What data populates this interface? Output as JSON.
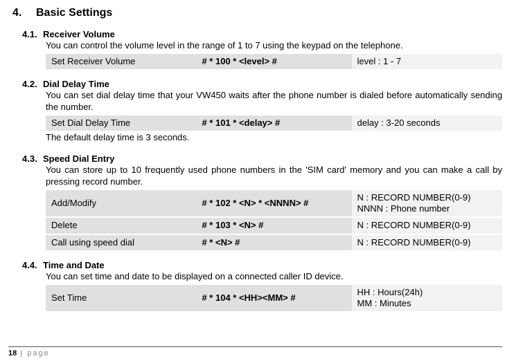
{
  "heading": {
    "number": "4.",
    "title": "Basic Settings"
  },
  "sections": {
    "s1": {
      "num": "4.1.",
      "title": "Receiver Volume",
      "desc": "You can control the volume level in the range of 1 to 7 using the keypad on the telephone.",
      "row": {
        "c1": "Set Receiver Volume",
        "c2": "# * 100 * <level> #",
        "c3": "level : 1 - 7"
      }
    },
    "s2": {
      "num": "4.2.",
      "title": "Dial Delay Time",
      "desc": "You can set dial delay time that your VW450 waits after the phone number is dialed before automatically sending the number.",
      "row": {
        "c1": "Set Dial Delay Time",
        "c2": "# * 101 * <delay> #",
        "c3": "delay : 3-20 seconds"
      },
      "note": "The default delay time is 3 seconds."
    },
    "s3": {
      "num": "4.3.",
      "title": "Speed Dial Entry",
      "desc": "You can store up to 10 frequently used phone numbers in the 'SIM card' memory and you can make a call by pressing record number.",
      "rows": {
        "r1": {
          "c1": "Add/Modify",
          "c2": "# * 102 * <N> * <NNNN> #",
          "c3": "N : RECORD NUMBER(0-9)\nNNNN : Phone number"
        },
        "r2": {
          "c1": "Delete",
          "c2": "# * 103 * <N> #",
          "c3": "N : RECORD NUMBER(0-9)"
        },
        "r3": {
          "c1": "Call using speed dial",
          "c2": "# * <N> #",
          "c3": "N : RECORD NUMBER(0-9)"
        }
      }
    },
    "s4": {
      "num": "4.4.",
      "title": "Time and Date",
      "desc": "You can set time and date to be displayed on a connected caller ID device.",
      "row": {
        "c1": "Set Time",
        "c2": "# * 104 * <HH><MM> #",
        "c3": "HH : Hours(24h)\nMM : Minutes"
      }
    }
  },
  "footer": {
    "page_num": "18",
    "separator": " | ",
    "label": "page"
  }
}
